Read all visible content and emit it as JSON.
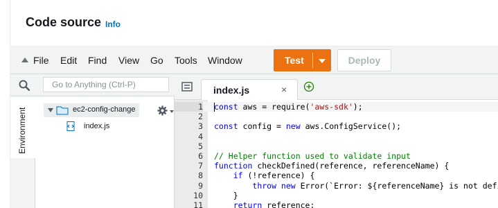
{
  "header": {
    "title": "Code source",
    "info_link": "Info"
  },
  "menubar": {
    "items": [
      "File",
      "Edit",
      "Find",
      "View",
      "Go",
      "Tools",
      "Window"
    ],
    "test_label": "Test",
    "deploy_label": "Deploy"
  },
  "sidebar": {
    "search_placeholder": "Go to Anything (Ctrl-P)",
    "environment_label": "Environment",
    "folder_name": "ec2-config-change",
    "file_name": "index.js"
  },
  "editor": {
    "tab_label": "index.js",
    "tab_close": "×",
    "lines": [
      {
        "num": "1",
        "tokens": [
          [
            "kw",
            "const"
          ],
          [
            "",
            "aws = require("
          ],
          [
            "str",
            "'aws-sdk'"
          ],
          [
            "",
            ");"
          ]
        ]
      },
      {
        "num": "2",
        "tokens": []
      },
      {
        "num": "3",
        "tokens": [
          [
            "kw",
            "const"
          ],
          [
            "",
            "config = "
          ],
          [
            "kw",
            "new"
          ],
          [
            "",
            "aws.ConfigService();"
          ]
        ]
      },
      {
        "num": "4",
        "tokens": []
      },
      {
        "num": "5",
        "tokens": []
      },
      {
        "num": "6",
        "tokens": [
          [
            "cm",
            "// Helper function used to validate input"
          ]
        ]
      },
      {
        "num": "7",
        "tokens": [
          [
            "kw",
            "function"
          ],
          [
            "",
            "checkDefined(reference, referenceName) {"
          ]
        ]
      },
      {
        "num": "8",
        "tokens": [
          [
            "",
            "    "
          ],
          [
            "kw",
            "if"
          ],
          [
            "",
            " (!reference) {"
          ]
        ]
      },
      {
        "num": "9",
        "tokens": [
          [
            "",
            "        "
          ],
          [
            "kw",
            "throw new"
          ],
          [
            "",
            " Error(`Error: ${referenceName} is not defined`);"
          ]
        ]
      },
      {
        "num": "10",
        "tokens": [
          [
            "",
            "    }"
          ]
        ]
      },
      {
        "num": "11",
        "tokens": [
          [
            "",
            "    "
          ],
          [
            "kw",
            "return"
          ],
          [
            "",
            " reference;"
          ]
        ]
      }
    ]
  },
  "colors": {
    "accent": "#ec7211",
    "link": "#0073bb"
  }
}
